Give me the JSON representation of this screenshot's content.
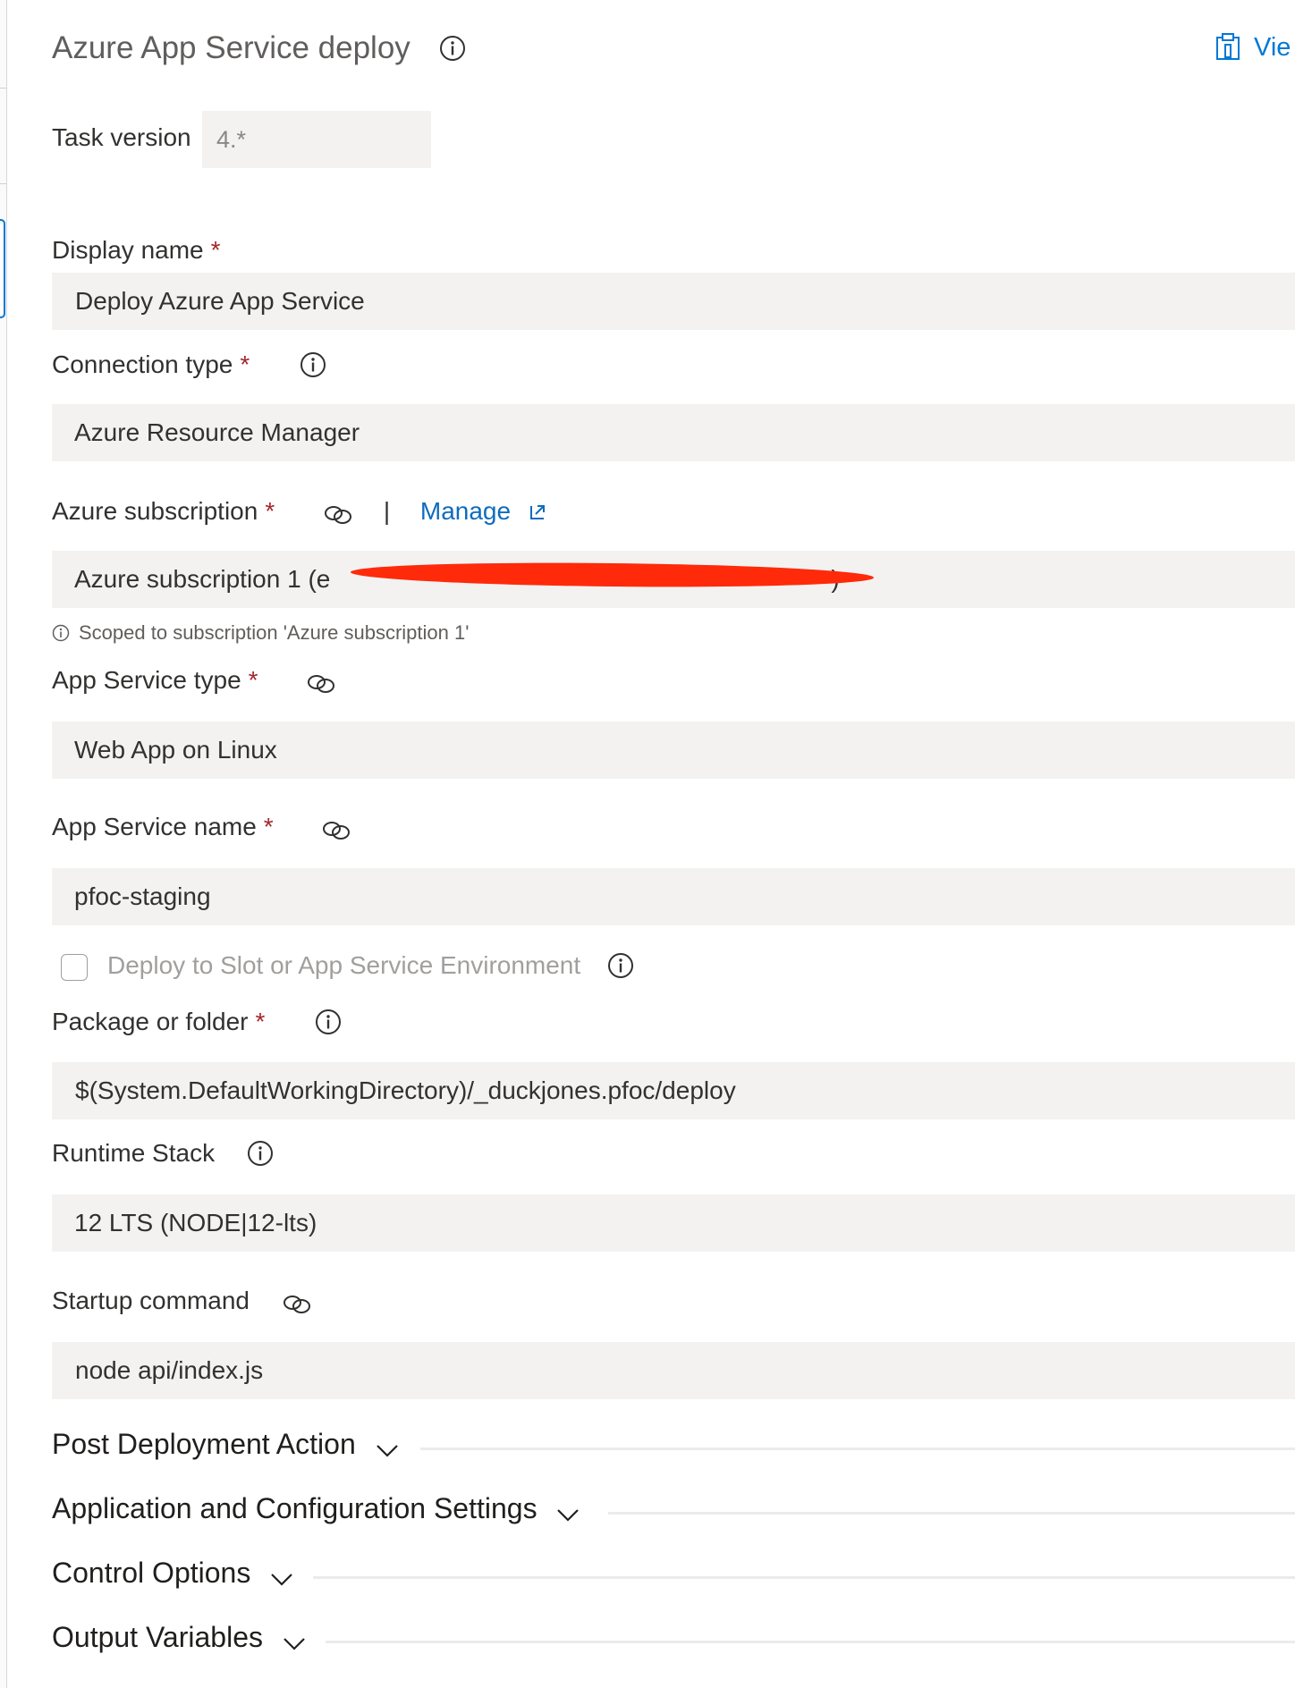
{
  "header": {
    "title": "Azure App Service deploy",
    "view_link": "Vie"
  },
  "task_version": {
    "label": "Task version",
    "value": "4.*"
  },
  "fields": {
    "display_name": {
      "label": "Display name",
      "value": "Deploy Azure App Service"
    },
    "connection_type": {
      "label": "Connection type",
      "value": "Azure Resource Manager"
    },
    "azure_subscription": {
      "label": "Azure subscription",
      "manage": "Manage",
      "value": "Azure subscription 1 (e",
      "value_tail": ")",
      "hint": "Scoped to subscription 'Azure subscription 1'"
    },
    "app_service_type": {
      "label": "App Service type",
      "value": "Web App on Linux"
    },
    "app_service_name": {
      "label": "App Service name",
      "value": "pfoc-staging"
    },
    "deploy_to_slot": {
      "label": "Deploy to Slot or App Service Environment",
      "checked": false
    },
    "package_or_folder": {
      "label": "Package or folder",
      "value": "$(System.DefaultWorkingDirectory)/_duckjones.pfoc/deploy"
    },
    "runtime_stack": {
      "label": "Runtime Stack",
      "value": "12 LTS (NODE|12-lts)"
    },
    "startup_command": {
      "label": "Startup command",
      "value": "node api/index.js"
    }
  },
  "required_marker": "*",
  "separator": "|",
  "sections": [
    {
      "label": "Post Deployment Action"
    },
    {
      "label": "Application and Configuration Settings"
    },
    {
      "label": "Control Options"
    },
    {
      "label": "Output Variables"
    }
  ],
  "colors": {
    "accent": "#0078d4",
    "required": "#a4262c",
    "field_bg": "#f3f2f1",
    "redaction": "#ff2a0a"
  },
  "icons": [
    "info-icon",
    "link-icon",
    "external-link-icon",
    "clipboard-icon",
    "chevron-down-icon"
  ]
}
